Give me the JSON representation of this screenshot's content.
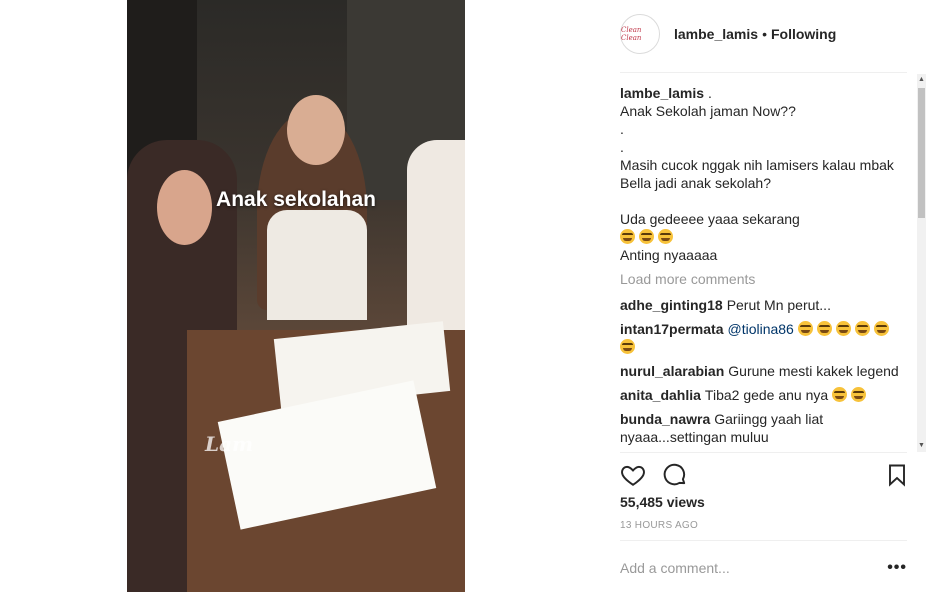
{
  "video": {
    "caption": "Anak sekolahan",
    "watermark": "Lam"
  },
  "post": {
    "avatar_text": "Clean Clean",
    "username": "lambe_lamis",
    "separator": "•",
    "follow_status": "Following",
    "caption_user": "lambe_lamis",
    "caption_lines": [
      " .",
      "Anak Sekolah jaman Now??",
      ".",
      ".",
      "Masih cucok nggak nih lamisers kalau mbak Bella jadi anak sekolah?",
      "",
      "Uda gedeeee yaaa sekarang"
    ],
    "caption_emoji_count": 3,
    "caption_last_line": "Anting nyaaaaa",
    "load_more": "Load more comments",
    "comments": [
      {
        "user": "adhe_ginting18",
        "text": "Perut Mn perut..."
      },
      {
        "user": "intan17permata",
        "mention": "@tiolina86",
        "text": "",
        "emoji_count": 6
      },
      {
        "user": "nurul_alarabian",
        "text": "Gurune mesti kakek legend"
      },
      {
        "user": "anita_dahlia",
        "text": "Tiba2 gede anu nya",
        "emoji_count": 2
      },
      {
        "user": "bunda_nawra",
        "text": "Gariingg yaah liat nyaaa...settingan muluu"
      }
    ],
    "views": "55,485 views",
    "time": "13 HOURS AGO",
    "comment_placeholder": "Add a comment...",
    "more_label": "•••"
  },
  "icons": {
    "like": "heart-icon",
    "comment": "comment-bubble-icon",
    "save": "bookmark-icon"
  }
}
